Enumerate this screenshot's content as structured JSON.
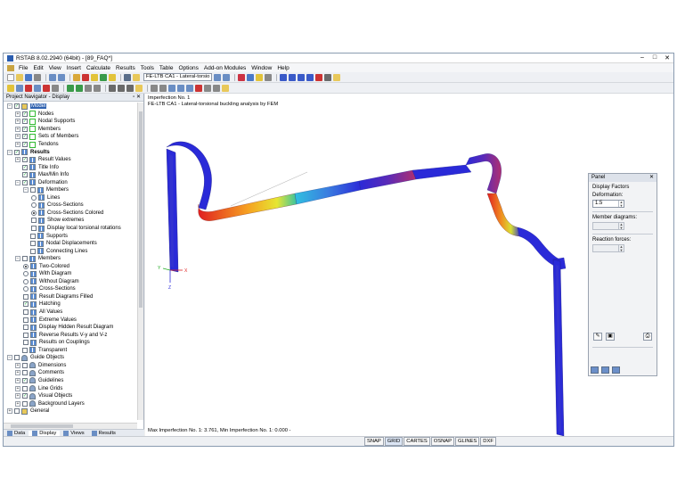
{
  "window": {
    "title": "RSTAB 8.02.2940 (64bit) - [89_FAQ*]"
  },
  "menu": [
    "File",
    "Edit",
    "View",
    "Insert",
    "Calculate",
    "Results",
    "Tools",
    "Table",
    "Options",
    "Add-on Modules",
    "Window",
    "Help"
  ],
  "toolbar": {
    "case_combo": "FE-LTB CA1 - Lateral-torsio"
  },
  "navigator": {
    "title": "Project Navigator - Display",
    "items": [
      {
        "level": 0,
        "exp": "-",
        "check": "on",
        "icon": "fold",
        "label": "Model",
        "selected": true
      },
      {
        "level": 1,
        "exp": "+",
        "check": "on",
        "icon": "node",
        "label": "Nodes"
      },
      {
        "level": 1,
        "exp": "+",
        "check": "on",
        "icon": "node",
        "label": "Nodal Supports"
      },
      {
        "level": 1,
        "exp": "+",
        "check": "on",
        "icon": "node",
        "label": "Members"
      },
      {
        "level": 1,
        "exp": "+",
        "check": "on",
        "icon": "node",
        "label": "Sets of Members"
      },
      {
        "level": 1,
        "exp": "+",
        "check": "on",
        "icon": "node",
        "label": "Tendons"
      },
      {
        "level": 0,
        "exp": "-",
        "check": "on",
        "icon": "grid",
        "label": "Results",
        "bold": true
      },
      {
        "level": 1,
        "exp": "+",
        "check": "on",
        "icon": "grid",
        "label": "Result Values"
      },
      {
        "level": 1,
        "exp": "",
        "check": "on",
        "icon": "grid",
        "label": "Title Info"
      },
      {
        "level": 1,
        "exp": "",
        "check": "on",
        "icon": "grid",
        "label": "Max/Min Info"
      },
      {
        "level": 1,
        "exp": "-",
        "check": "on",
        "icon": "grid",
        "label": "Deformation"
      },
      {
        "level": 2,
        "exp": "-",
        "check": "off",
        "icon": "grid",
        "label": "Members"
      },
      {
        "level": 3,
        "radio": "off",
        "icon": "grid",
        "label": "Lines"
      },
      {
        "level": 3,
        "radio": "off",
        "icon": "grid",
        "label": "Cross-Sections"
      },
      {
        "level": 3,
        "radio": "on",
        "icon": "grid",
        "label": "Cross-Sections Colored"
      },
      {
        "level": 3,
        "check": "off",
        "icon": "grid",
        "label": "Show extremes"
      },
      {
        "level": 3,
        "check": "off",
        "icon": "grid",
        "label": "Display local torsional rotations"
      },
      {
        "level": 2,
        "exp": "",
        "check": "off",
        "icon": "grid",
        "label": "Supports"
      },
      {
        "level": 2,
        "exp": "",
        "check": "off",
        "icon": "grid",
        "label": "Nodal Displacements"
      },
      {
        "level": 2,
        "exp": "",
        "check": "off",
        "icon": "grid",
        "label": "Connecting Lines"
      },
      {
        "level": 1,
        "exp": "-",
        "check": "off",
        "icon": "grid",
        "label": "Members"
      },
      {
        "level": 2,
        "radio": "on",
        "icon": "grid",
        "label": "Two-Colored"
      },
      {
        "level": 2,
        "radio": "off",
        "icon": "grid",
        "label": "With Diagram"
      },
      {
        "level": 2,
        "radio": "off",
        "icon": "grid",
        "label": "Without Diagram"
      },
      {
        "level": 2,
        "radio": "off",
        "icon": "grid",
        "label": "Cross-Sections"
      },
      {
        "level": 2,
        "check": "off",
        "icon": "grid",
        "label": "Result Diagrams Filled"
      },
      {
        "level": 2,
        "check": "on",
        "icon": "grid",
        "label": "Hatching"
      },
      {
        "level": 2,
        "check": "off",
        "icon": "grid",
        "label": "All Values"
      },
      {
        "level": 2,
        "check": "off",
        "icon": "grid",
        "label": "Extreme Values"
      },
      {
        "level": 2,
        "check": "off",
        "icon": "grid",
        "label": "Display Hidden Result Diagram"
      },
      {
        "level": 2,
        "check": "off",
        "icon": "grid",
        "label": "Reverse Results V-y and V-z"
      },
      {
        "level": 2,
        "check": "off",
        "icon": "grid",
        "label": "Results on Couplings"
      },
      {
        "level": 1,
        "exp": "",
        "check": "off",
        "icon": "grid",
        "label": "Transparent"
      },
      {
        "level": 0,
        "exp": "-",
        "check": "off",
        "icon": "guide",
        "label": "Guide Objects"
      },
      {
        "level": 1,
        "exp": "+",
        "check": "off",
        "icon": "guide",
        "label": "Dimensions"
      },
      {
        "level": 1,
        "exp": "+",
        "check": "off",
        "icon": "guide",
        "label": "Comments"
      },
      {
        "level": 1,
        "exp": "+",
        "check": "on",
        "icon": "guide",
        "label": "Guidelines"
      },
      {
        "level": 1,
        "exp": "+",
        "check": "off",
        "icon": "guide",
        "label": "Line Grids"
      },
      {
        "level": 1,
        "exp": "+",
        "check": "on",
        "icon": "guide",
        "label": "Visual Objects"
      },
      {
        "level": 1,
        "exp": "+",
        "check": "off",
        "icon": "guide",
        "label": "Background Layers"
      },
      {
        "level": 0,
        "exp": "+",
        "check": "off",
        "icon": "fold",
        "label": "General"
      }
    ],
    "tabs": [
      "Data",
      "Display",
      "Views",
      "Results"
    ]
  },
  "view": {
    "header_line1": "Imperfection No. 1",
    "header_line2": "FE-LTB CA1 - Lateral-torsional buckling analysis by FEM",
    "footer": "Max Imperfection No. 1: 3.761, Min Imperfection No. 1: 0.000 -",
    "axes": {
      "x": "X",
      "y": "Y",
      "z": "Z"
    }
  },
  "panel": {
    "title": "Panel",
    "section": "Display Factors",
    "deformation_label": "Deformation:",
    "deformation_value": "1.5",
    "member_label": "Member diagrams:",
    "reaction_label": "Reaction forces:"
  },
  "status": {
    "buttons": [
      "SNAP",
      "GRID",
      "CARTES",
      "OSNAP",
      "GLINES",
      "DXF"
    ]
  },
  "colors": {
    "accent": "#2f62b0",
    "beam_blue": "#2a2ad8",
    "beam_red": "#e02020"
  }
}
